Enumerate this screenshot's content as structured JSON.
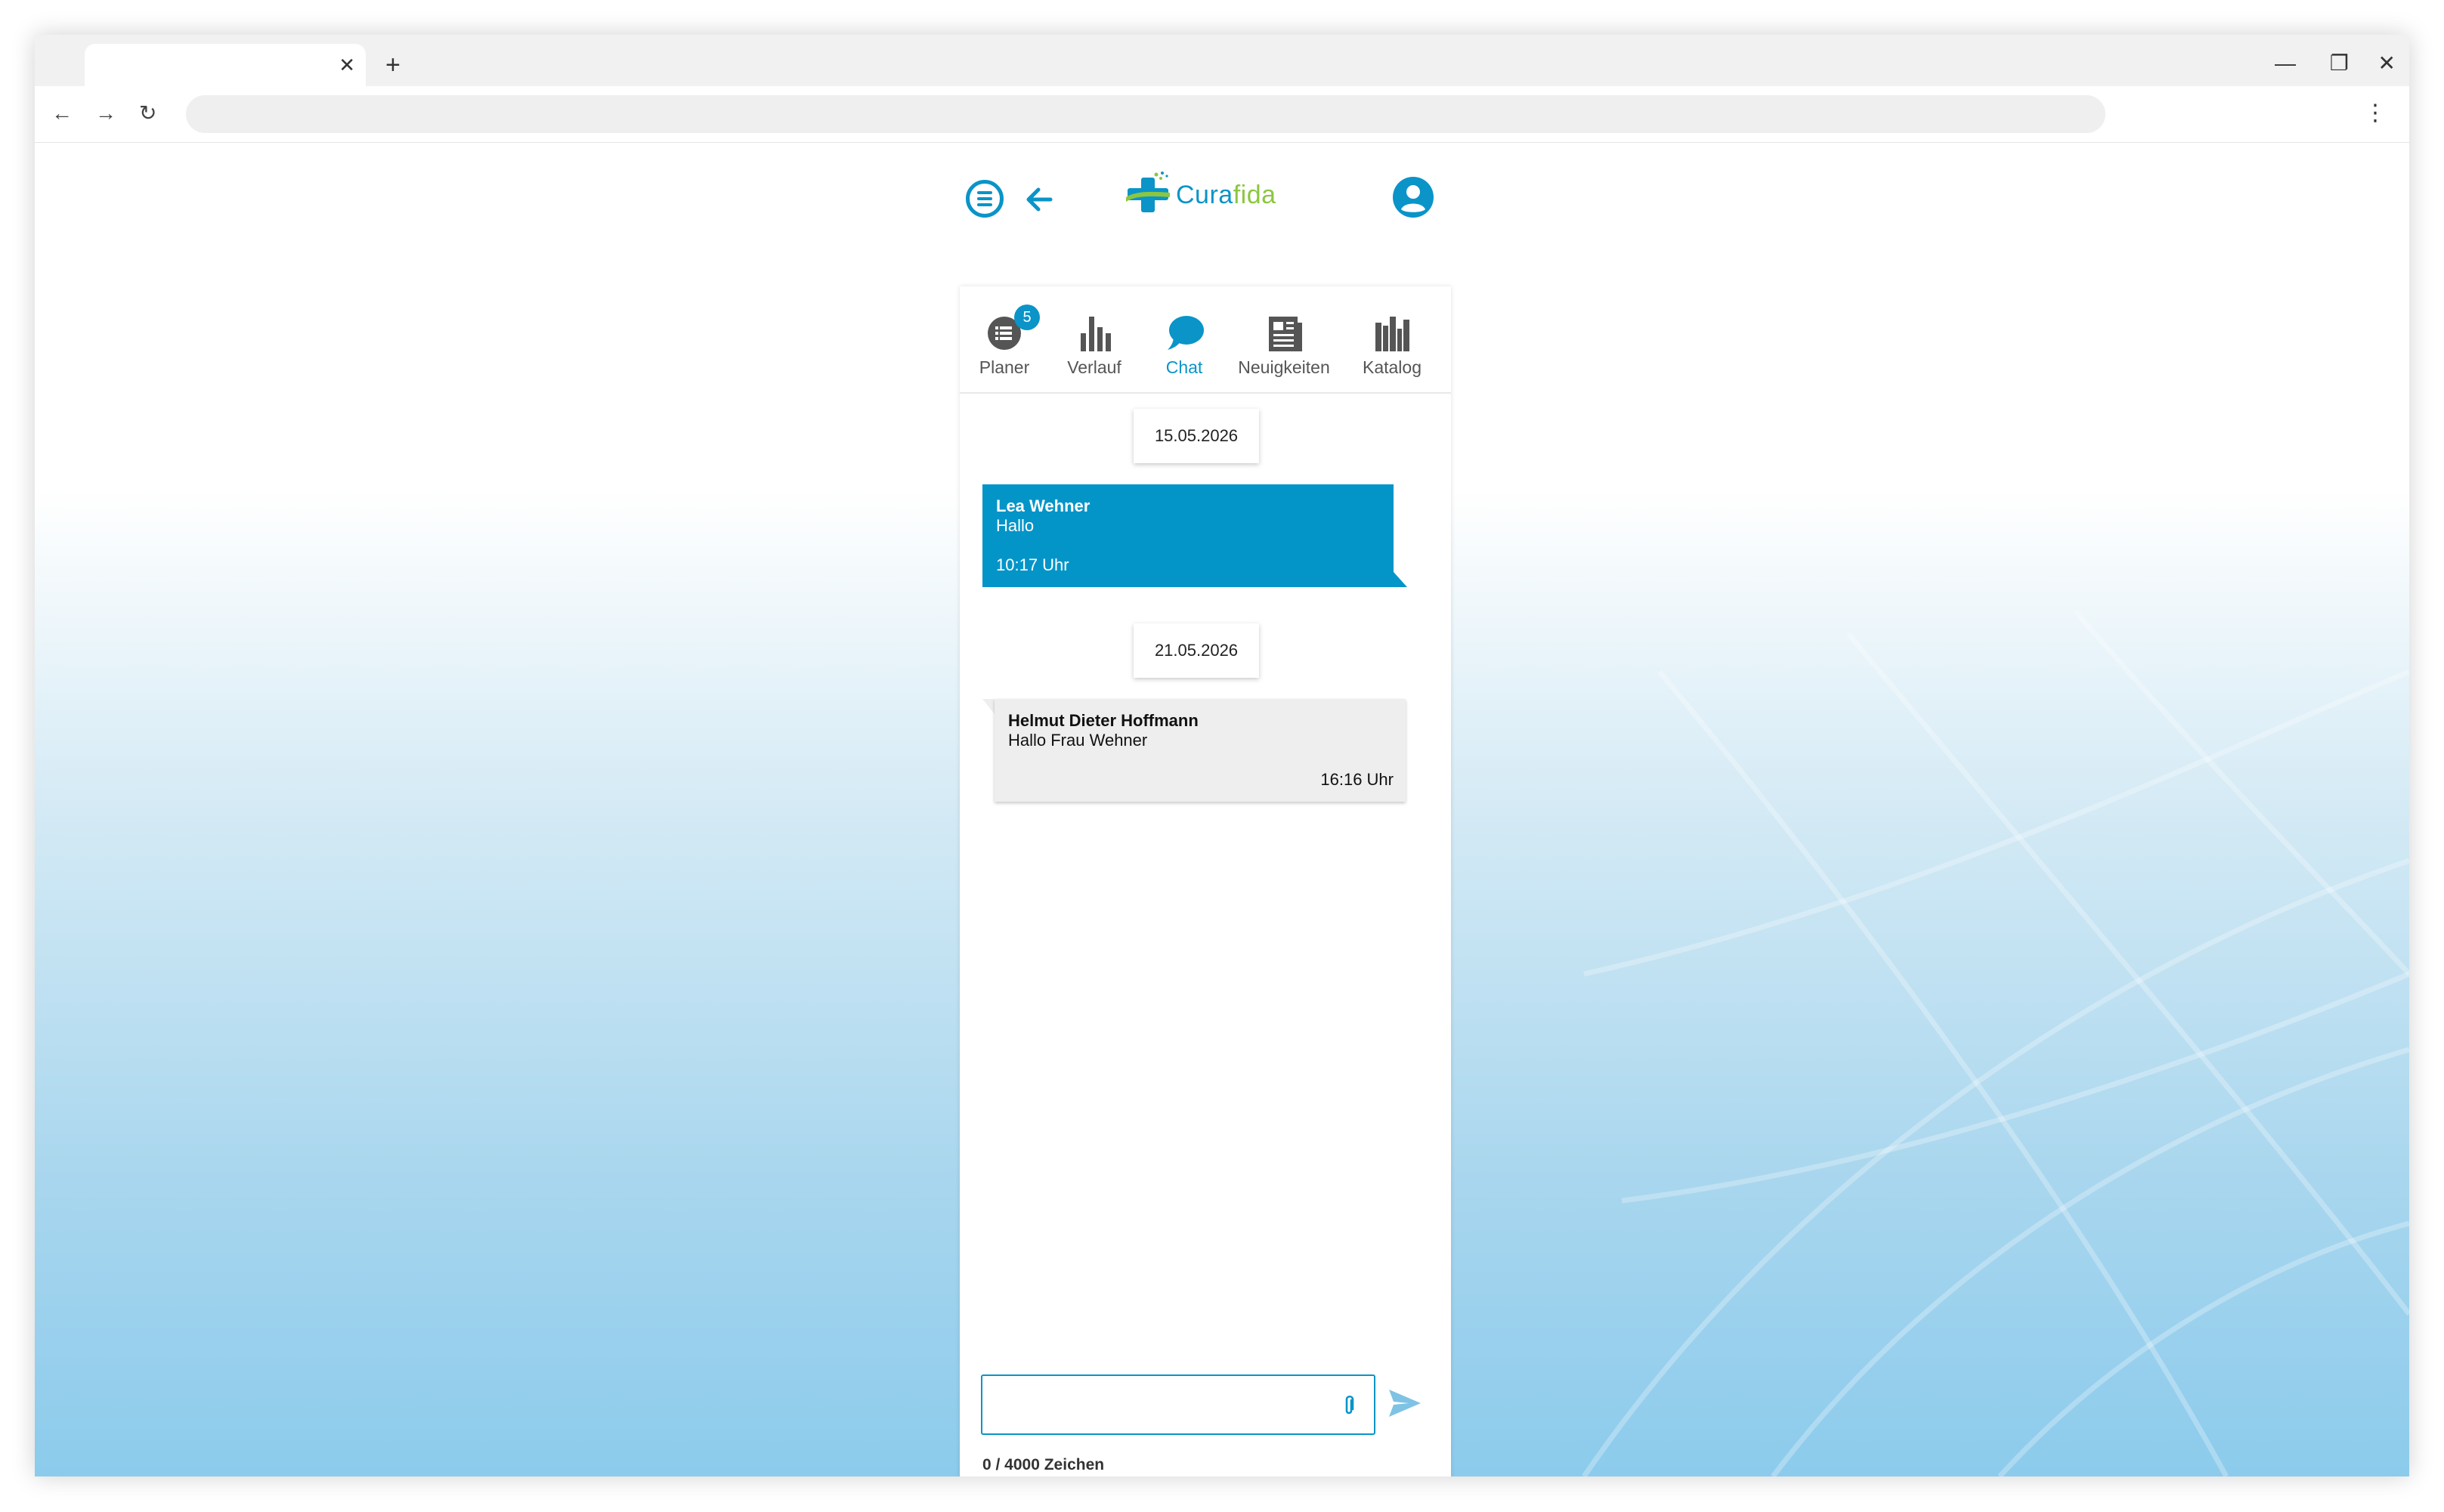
{
  "browser": {
    "tab_close_glyph": "✕",
    "newtab_glyph": "+",
    "minimize_glyph": "—",
    "restore_glyph": "❐",
    "close_glyph": "✕",
    "back_glyph": "←",
    "forward_glyph": "→",
    "reload_glyph": "↻",
    "menu_glyph": "⋮",
    "url": ""
  },
  "app": {
    "logo_part1": "Cura",
    "logo_part2": "fida",
    "colors": {
      "primary": "#0a94c8",
      "logo_green": "#8cc63f",
      "bubble_out": "#0495c8",
      "bubble_in": "#eeeeee",
      "icon_gray": "#555555"
    }
  },
  "nav": {
    "tabs": [
      {
        "label": "Planer",
        "icon": "list-icon",
        "badge": "5"
      },
      {
        "label": "Verlauf",
        "icon": "bar-chart-icon"
      },
      {
        "label": "Chat",
        "icon": "chat-icon",
        "active": true
      },
      {
        "label": "Neuigkeiten",
        "icon": "newspaper-icon"
      },
      {
        "label": "Katalog",
        "icon": "books-icon"
      }
    ]
  },
  "chat": {
    "groups": [
      {
        "date": "15.05.2026",
        "message": {
          "direction": "outgoing",
          "sender": "Lea Wehner",
          "text": "Hallo",
          "time": "10:17 Uhr"
        }
      },
      {
        "date": "21.05.2026",
        "message": {
          "direction": "incoming",
          "sender": "Helmut Dieter Hoffmann",
          "text": "Hallo Frau Wehner",
          "time": "16:16 Uhr"
        }
      }
    ],
    "input": {
      "value": "",
      "placeholder": ""
    },
    "counter": "0 / 4000 Zeichen"
  }
}
